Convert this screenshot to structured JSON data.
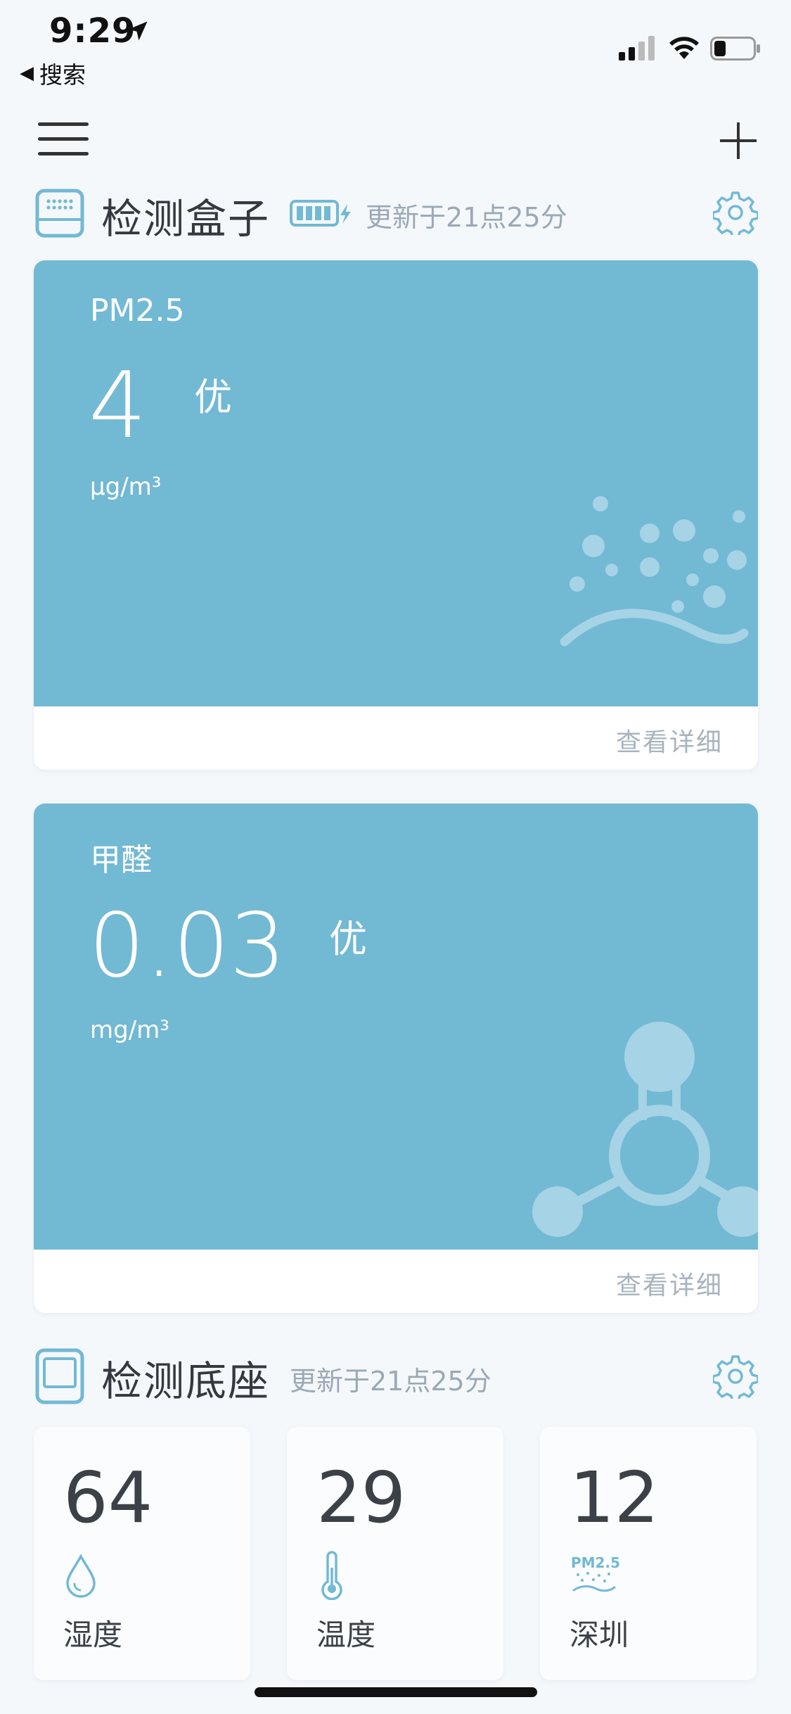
{
  "status_bar": {
    "time": "9:29",
    "back_label": "搜索"
  },
  "box_section": {
    "title": "检测盒子",
    "update_text": "更新于21点25分"
  },
  "pm25_card": {
    "label": "PM2.5",
    "value": "4",
    "grade": "优",
    "unit": "μg/m³",
    "detail_link": "查看详细"
  },
  "formaldehyde_card": {
    "label": "甲醛",
    "value": "0.03",
    "grade": "优",
    "unit": "mg/m³",
    "detail_link": "查看详细"
  },
  "base_section": {
    "title": "检测底座",
    "update_text": "更新于21点25分"
  },
  "tiles": [
    {
      "value": "64",
      "label": "湿度",
      "icon": "droplet-icon"
    },
    {
      "value": "29",
      "label": "温度",
      "icon": "thermometer-icon"
    },
    {
      "value": "12",
      "label": "深圳",
      "icon": "pm25-icon",
      "icon_text": "PM2.5"
    }
  ],
  "colors": {
    "accent": "#72b9d4",
    "background": "#f5f8fb",
    "muted_text": "#9aa9b6"
  }
}
